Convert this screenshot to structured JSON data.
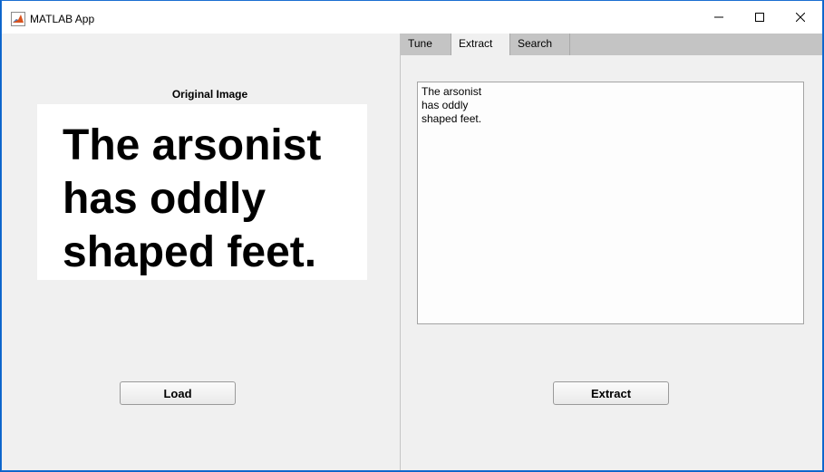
{
  "window": {
    "title": "MATLAB App",
    "controls": {
      "minimize": "minimize",
      "maximize": "maximize",
      "close": "close"
    }
  },
  "left_panel": {
    "image_title": "Original Image",
    "image_lines": [
      "The arsonist",
      "has oddly",
      "shaped feet."
    ],
    "load_label": "Load"
  },
  "tabs": [
    {
      "label": "Tune",
      "selected": false
    },
    {
      "label": "Extract",
      "selected": true
    },
    {
      "label": "Search",
      "selected": false
    }
  ],
  "extract_tab": {
    "text_lines": [
      "The arsonist",
      "has oddly",
      "shaped feet."
    ],
    "extract_label": "Extract"
  },
  "icons": {
    "app": "matlab-logo-icon",
    "minimize": "minimize-icon",
    "maximize": "maximize-icon",
    "close": "close-icon"
  },
  "colors": {
    "window_border": "#1b6fd1",
    "panel_background": "#f0f0f0",
    "tab_bar": "#c4c4c4"
  }
}
